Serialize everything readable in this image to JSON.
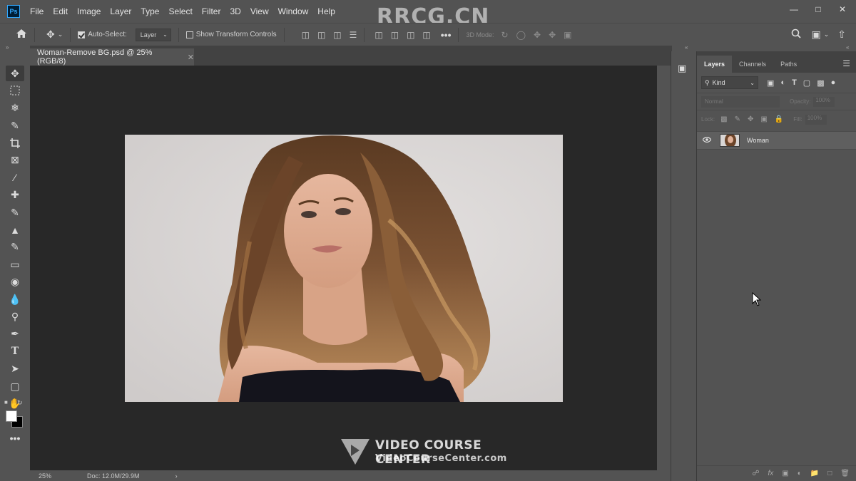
{
  "app": {
    "logo": "Ps",
    "menu": [
      "File",
      "Edit",
      "Image",
      "Layer",
      "Type",
      "Select",
      "Filter",
      "3D",
      "View",
      "Window",
      "Help"
    ],
    "watermark": "RRCG.CN"
  },
  "options": {
    "auto_select_label": "Auto-Select:",
    "auto_select_checked": true,
    "auto_select_target": "Layer",
    "show_transform_label": "Show Transform Controls",
    "show_transform_checked": false,
    "mode_label": "3D Mode:"
  },
  "document": {
    "tab_title": "Woman-Remove BG.psd @ 25% (RGB/8)",
    "zoom": "25%",
    "doc_size": "Doc: 12.0M/29.9M",
    "canvas_bg": "#282828",
    "image_bg": "#d9d6d5"
  },
  "layers_panel": {
    "tabs": [
      "Layers",
      "Channels",
      "Paths"
    ],
    "active_tab": "Layers",
    "filter_kind": "Kind",
    "blend_mode": "Normal",
    "opacity_label": "Opacity:",
    "opacity_value": "100%",
    "lock_label": "Lock:",
    "fill_label": "Fill:",
    "fill_value": "100%",
    "layers": [
      {
        "name": "Woman",
        "visible": true
      }
    ]
  },
  "watermark": {
    "title": "VIDEO COURSE CENTER",
    "url": "VideoCourseCenter.com"
  }
}
